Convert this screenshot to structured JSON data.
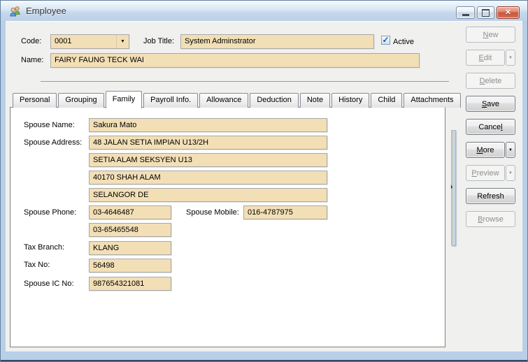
{
  "window": {
    "title": "Employee",
    "controls": {
      "minimize": "Minimize",
      "maximize": "Maximize",
      "close": "Close"
    }
  },
  "icons": {
    "close": "✕",
    "dropdown": "▼",
    "combo_arrow": "▼",
    "splitter_arrow": "›",
    "check": "✓"
  },
  "header": {
    "code_label": "Code:",
    "code_value": "0001",
    "job_title_label": "Job Title:",
    "job_title_value": "System Adminstrator",
    "active_label": "Active",
    "active_checked": true,
    "name_label": "Name:",
    "name_value": "FAIRY FAUNG TECK WAI"
  },
  "tabs": [
    {
      "label": "Personal",
      "active": false
    },
    {
      "label": "Grouping",
      "active": false
    },
    {
      "label": "Family",
      "active": true
    },
    {
      "label": "Payroll Info.",
      "active": false
    },
    {
      "label": "Allowance",
      "active": false
    },
    {
      "label": "Deduction",
      "active": false
    },
    {
      "label": "Note",
      "active": false
    },
    {
      "label": "History",
      "active": false
    },
    {
      "label": "Child",
      "active": false
    },
    {
      "label": "Attachments",
      "active": false
    }
  ],
  "family_form": {
    "spouse_name_label": "Spouse Name:",
    "spouse_name": "Sakura Mato",
    "spouse_address_label": "Spouse Address:",
    "spouse_address_lines": [
      "48 JALAN SETIA IMPIAN U13/2H",
      "SETIA ALAM SEKSYEN U13",
      "40170 SHAH ALAM",
      "SELANGOR DE"
    ],
    "spouse_phone_label": "Spouse Phone:",
    "spouse_phone_1": "03-4646487",
    "spouse_phone_2": "03-65465548",
    "spouse_mobile_label": "Spouse Mobile:",
    "spouse_mobile": "016-4787975",
    "tax_branch_label": "Tax Branch:",
    "tax_branch": "KLANG",
    "tax_no_label": "Tax No:",
    "tax_no": "56498",
    "spouse_ic_label": "Spouse IC No:",
    "spouse_ic": "987654321081"
  },
  "action_buttons": [
    {
      "id": "new",
      "text": "New",
      "underline": 0,
      "enabled": false,
      "split": false
    },
    {
      "id": "edit",
      "text": "Edit",
      "underline": 0,
      "enabled": false,
      "split": true
    },
    {
      "id": "delete",
      "text": "Delete",
      "underline": 0,
      "enabled": false,
      "split": false
    },
    {
      "id": "save",
      "text": "Save",
      "underline": 0,
      "enabled": true,
      "split": false
    },
    {
      "id": "cancel",
      "text": "Cancel",
      "underline": 5,
      "enabled": true,
      "split": false
    },
    {
      "id": "more",
      "text": "More",
      "underline": 0,
      "enabled": true,
      "split": true
    },
    {
      "id": "preview",
      "text": "Preview",
      "underline": 0,
      "enabled": false,
      "split": true
    },
    {
      "id": "refresh",
      "text": "Refresh",
      "underline": -1,
      "enabled": true,
      "split": false
    },
    {
      "id": "browse",
      "text": "Browse",
      "underline": 0,
      "enabled": false,
      "split": false
    }
  ],
  "colors": {
    "field_bg": "#F2DFB6",
    "frame_blue": "#B9CFE7",
    "titlebar_top": "#F4F9FD",
    "titlebar_bottom": "#BCD0E8",
    "close_button_red": "#C8543C",
    "client_bg": "#F0F0EF",
    "check_blue": "#1C5BB0"
  }
}
